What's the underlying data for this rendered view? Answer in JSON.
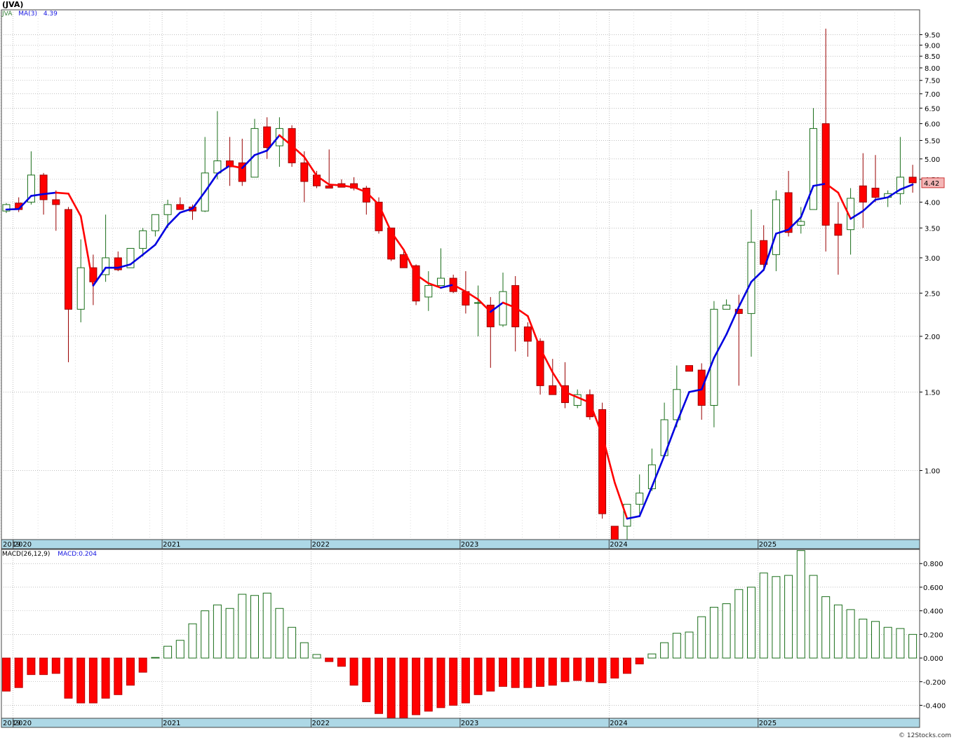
{
  "title": "(JVA)",
  "footer": "© 12Stocks.com",
  "legend": {
    "symbol": "JVA",
    "ma_label": "MA(3)",
    "ma_value": "4.39",
    "macd_label": "MACD(26,12,9)",
    "macd_value": "MACD:0.204"
  },
  "last_price_label": "4.42",
  "colors": {
    "up": "#1a6e1a",
    "down": "#ff0000",
    "ma_up": "#0000e0",
    "ma_down": "#ff0000",
    "axis_band": "#add8e6",
    "grid": "#999999"
  },
  "chart_data": [
    {
      "type": "candlestick",
      "scale": "log",
      "ylim": [
        0.7,
        10.8
      ],
      "yticks": [
        "1.00",
        "1.50",
        "2.00",
        "2.50",
        "3.00",
        "3.50",
        "4.00",
        "4.50",
        "5.00",
        "5.50",
        "6.00",
        "6.50",
        "7.00",
        "7.50",
        "8.00",
        "8.50",
        "9.00",
        "9.50"
      ],
      "year_labels": [
        "2019",
        "2020",
        "2021",
        "2022",
        "2023",
        "2024",
        "2025"
      ],
      "period": "monthly",
      "start_month": "2019-12",
      "candles": [
        [
          3.82,
          3.98,
          3.78,
          3.95
        ],
        [
          3.98,
          4.1,
          3.8,
          3.85
        ],
        [
          4.0,
          5.2,
          3.95,
          4.6
        ],
        [
          4.6,
          4.65,
          3.75,
          4.05
        ],
        [
          4.05,
          4.25,
          3.45,
          3.95
        ],
        [
          3.85,
          3.9,
          1.75,
          2.3
        ],
        [
          2.3,
          3.3,
          2.15,
          2.85
        ],
        [
          2.85,
          3.05,
          2.35,
          2.65
        ],
        [
          2.75,
          3.75,
          2.65,
          3.0
        ],
        [
          3.0,
          3.1,
          2.8,
          2.82
        ],
        [
          2.85,
          3.15,
          2.85,
          3.15
        ],
        [
          3.15,
          3.5,
          3.02,
          3.45
        ],
        [
          3.45,
          3.75,
          3.35,
          3.75
        ],
        [
          3.75,
          4.05,
          3.5,
          3.95
        ],
        [
          3.95,
          4.1,
          3.85,
          3.85
        ],
        [
          3.9,
          3.95,
          3.65,
          3.82
        ],
        [
          3.82,
          5.6,
          3.8,
          4.65
        ],
        [
          4.65,
          6.4,
          4.5,
          4.95
        ],
        [
          4.95,
          5.6,
          4.35,
          4.8
        ],
        [
          4.9,
          5.55,
          4.35,
          4.45
        ],
        [
          4.55,
          6.15,
          4.55,
          5.85
        ],
        [
          5.9,
          6.2,
          5.0,
          5.3
        ],
        [
          5.35,
          6.2,
          4.8,
          5.85
        ],
        [
          5.85,
          5.95,
          4.8,
          4.9
        ],
        [
          4.9,
          5.2,
          4.0,
          4.45
        ],
        [
          4.6,
          4.7,
          4.3,
          4.35
        ],
        [
          4.35,
          5.25,
          4.3,
          4.3
        ],
        [
          4.4,
          4.5,
          4.35,
          4.32
        ],
        [
          4.4,
          4.55,
          4.25,
          4.3
        ],
        [
          4.3,
          4.35,
          3.75,
          4.0
        ],
        [
          4.0,
          4.1,
          3.4,
          3.45
        ],
        [
          3.5,
          3.5,
          2.95,
          2.98
        ],
        [
          3.05,
          3.1,
          2.85,
          2.85
        ],
        [
          2.88,
          2.9,
          2.35,
          2.4
        ],
        [
          2.45,
          2.8,
          2.28,
          2.6
        ],
        [
          2.6,
          3.15,
          2.6,
          2.7
        ],
        [
          2.7,
          2.75,
          2.5,
          2.52
        ],
        [
          2.52,
          2.8,
          2.25,
          2.35
        ],
        [
          2.38,
          2.6,
          2.0,
          2.38
        ],
        [
          2.35,
          2.45,
          1.7,
          2.1
        ],
        [
          2.12,
          2.78,
          2.1,
          2.52
        ],
        [
          2.6,
          2.73,
          1.85,
          2.1
        ],
        [
          2.1,
          2.15,
          1.8,
          1.95
        ],
        [
          1.95,
          1.98,
          1.48,
          1.55
        ],
        [
          1.55,
          1.78,
          1.48,
          1.48
        ],
        [
          1.55,
          1.75,
          1.38,
          1.42
        ],
        [
          1.4,
          1.52,
          1.38,
          1.48
        ],
        [
          1.48,
          1.52,
          1.3,
          1.32
        ],
        [
          1.37,
          1.42,
          0.78,
          0.8
        ],
        [
          0.75,
          0.75,
          0.68,
          0.68
        ],
        [
          0.75,
          0.84,
          0.69,
          0.84
        ],
        [
          0.84,
          0.98,
          0.8,
          0.89
        ],
        [
          0.91,
          1.12,
          0.9,
          1.03
        ],
        [
          1.08,
          1.42,
          1.08,
          1.3
        ],
        [
          1.3,
          1.72,
          1.25,
          1.52
        ],
        [
          1.72,
          1.72,
          1.67,
          1.67
        ],
        [
          1.68,
          1.74,
          1.3,
          1.4
        ],
        [
          1.4,
          2.4,
          1.25,
          2.3
        ],
        [
          2.3,
          2.42,
          2.3,
          2.35
        ],
        [
          2.3,
          2.48,
          1.55,
          2.25
        ],
        [
          2.25,
          3.85,
          1.8,
          3.25
        ],
        [
          3.28,
          3.55,
          2.8,
          2.9
        ],
        [
          3.05,
          4.25,
          2.8,
          4.05
        ],
        [
          4.2,
          4.7,
          3.35,
          3.42
        ],
        [
          3.55,
          3.9,
          3.4,
          3.62
        ],
        [
          3.85,
          6.5,
          3.85,
          5.85
        ],
        [
          6.0,
          9.8,
          3.1,
          3.55
        ],
        [
          3.57,
          4.0,
          2.75,
          3.37
        ],
        [
          3.47,
          4.3,
          3.05,
          4.08
        ],
        [
          4.35,
          5.15,
          3.5,
          4.0
        ],
        [
          4.3,
          5.1,
          4.0,
          4.1
        ],
        [
          4.1,
          4.25,
          3.9,
          4.18
        ],
        [
          4.18,
          5.6,
          3.95,
          4.55
        ],
        [
          4.55,
          4.85,
          4.2,
          4.42
        ]
      ],
      "ma3": [
        3.85,
        3.86,
        4.13,
        4.17,
        4.2,
        4.18,
        3.72,
        2.6,
        2.85,
        2.85,
        2.9,
        3.05,
        3.21,
        3.55,
        3.79,
        3.87,
        4.22,
        4.63,
        4.83,
        4.77,
        5.1,
        5.22,
        5.65,
        5.35,
        5.05,
        4.58,
        4.38,
        4.36,
        4.32,
        4.21,
        3.95,
        3.43,
        3.13,
        2.75,
        2.63,
        2.57,
        2.61,
        2.52,
        2.42,
        2.27,
        2.38,
        2.32,
        2.22,
        1.88,
        1.66,
        1.5,
        1.46,
        1.42,
        1.2,
        0.94,
        0.78,
        0.79,
        0.92,
        1.08,
        1.28,
        1.5,
        1.52,
        1.79,
        2.02,
        2.33,
        2.65,
        2.82,
        3.4,
        3.47,
        3.7,
        4.35,
        4.4,
        4.2,
        3.67,
        3.82,
        4.05,
        4.1,
        4.27,
        4.38
      ],
      "series": [
        {
          "name": "JVA"
        },
        {
          "name": "MA(3)"
        }
      ]
    },
    {
      "type": "bar",
      "ylim": [
        -0.51,
        0.92
      ],
      "yticks": [
        "0.800",
        "0.600",
        "0.400",
        "0.200",
        "0.000",
        "-0.200",
        "-0.400"
      ],
      "values": [
        -0.28,
        -0.25,
        -0.14,
        -0.14,
        -0.13,
        -0.34,
        -0.38,
        -0.38,
        -0.34,
        -0.31,
        -0.23,
        -0.12,
        0.005,
        0.1,
        0.15,
        0.29,
        0.4,
        0.45,
        0.42,
        0.54,
        0.53,
        0.55,
        0.42,
        0.26,
        0.13,
        0.03,
        -0.03,
        -0.07,
        -0.23,
        -0.37,
        -0.47,
        -0.51,
        -0.53,
        -0.48,
        -0.45,
        -0.42,
        -0.4,
        -0.38,
        -0.31,
        -0.28,
        -0.24,
        -0.25,
        -0.25,
        -0.24,
        -0.23,
        -0.2,
        -0.19,
        -0.2,
        -0.21,
        -0.17,
        -0.13,
        -0.05,
        0.035,
        0.13,
        0.21,
        0.22,
        0.35,
        0.43,
        0.46,
        0.58,
        0.6,
        0.72,
        0.69,
        0.7,
        0.91,
        0.7,
        0.52,
        0.45,
        0.41,
        0.33,
        0.31,
        0.26,
        0.25,
        0.2
      ]
    }
  ]
}
